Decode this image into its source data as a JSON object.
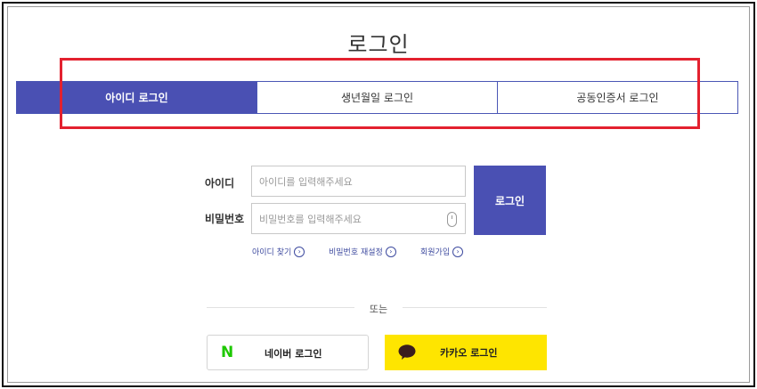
{
  "page": {
    "title": "로그인"
  },
  "tabs": [
    {
      "label": "아이디 로그인",
      "active": true
    },
    {
      "label": "생년월일 로그인",
      "active": false
    },
    {
      "label": "공동인증서 로그인",
      "active": false
    }
  ],
  "form": {
    "id_label": "아이디",
    "id_placeholder": "아이디를 입력해주세요",
    "password_label": "비밀번호",
    "password_placeholder": "비밀번호를 입력해주세요",
    "login_button": "로그인"
  },
  "links": {
    "find_id": "아이디 찾기",
    "reset_password": "비밀번호 재설정",
    "signup": "회원가입"
  },
  "divider": {
    "or_text": "또는"
  },
  "social": {
    "naver_label": "네이버 로그인",
    "naver_logo": "N",
    "kakao_label": "카카오 로그인"
  },
  "colors": {
    "accent": "#4a50b3",
    "highlight": "#e3212f",
    "naver_green": "#1ec800",
    "kakao_yellow": "#fee500"
  }
}
